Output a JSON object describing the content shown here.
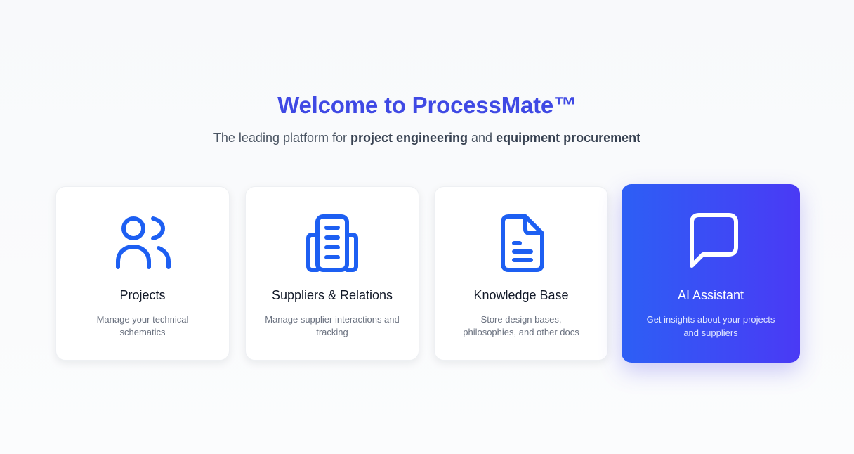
{
  "hero": {
    "title": "Welcome to ProcessMate™",
    "subtitle_prefix": "The leading platform for ",
    "subtitle_bold_1": "project engineering",
    "subtitle_middle": " and ",
    "subtitle_bold_2": "equipment procurement"
  },
  "colors": {
    "title": "#3f49e4",
    "icon": "#1d5ff2",
    "active_gradient_start": "#2d5ff5",
    "active_gradient_end": "#4a3af5"
  },
  "cards": [
    {
      "icon": "users-icon",
      "title": "Projects",
      "description": "Manage your technical schematics"
    },
    {
      "icon": "building-icon",
      "title": "Suppliers & Relations",
      "description": "Manage supplier interactions and tracking"
    },
    {
      "icon": "document-icon",
      "title": "Knowledge Base",
      "description": "Store design bases, philosophies, and other docs"
    },
    {
      "icon": "chat-icon",
      "title": "AI Assistant",
      "description": "Get insights about your projects and suppliers",
      "active": true
    }
  ]
}
